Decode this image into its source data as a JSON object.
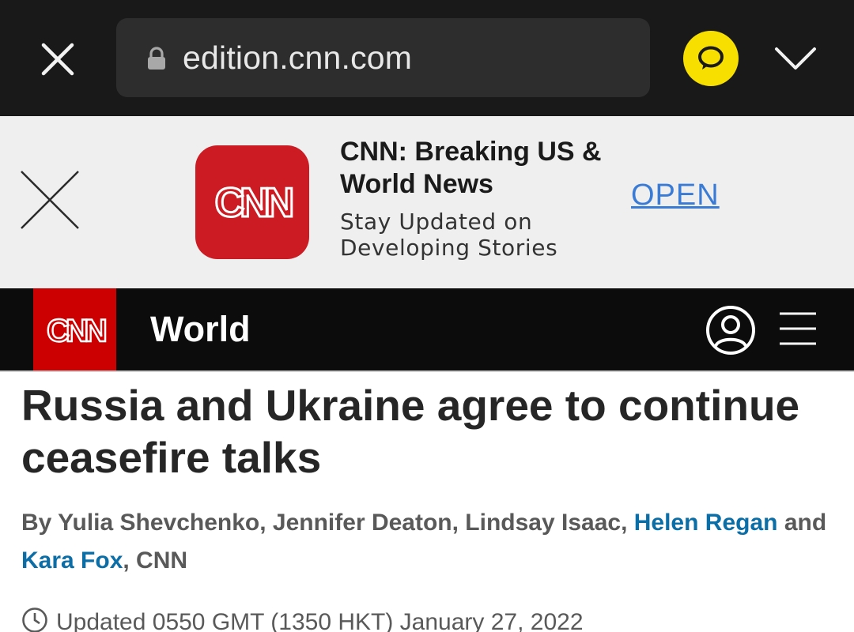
{
  "browser": {
    "url": "edition.cnn.com"
  },
  "app_banner": {
    "app_title": "CNN: Breaking US & World News",
    "app_subtitle": "Stay Updated on Developing Stories",
    "open_label": "OPEN",
    "icon_text": "CNN",
    "icon_color": "#cc1b22"
  },
  "header": {
    "logo_text": "CNN",
    "section": "World",
    "logo_color": "#cc0000"
  },
  "article": {
    "headline": "Russia and Ukraine agree to continue ceasefire talks",
    "byline_prefix": "By Yulia Shevchenko, Jennifer Deaton, Lindsay Isaac,",
    "author_link_1": "Helen Regan",
    "byline_and": "and",
    "author_link_2": "Kara Fox",
    "byline_suffix": ", CNN",
    "updated": "Updated 0550 GMT (1350 HKT) January 27, 2022"
  },
  "icons": [
    "close-icon",
    "lock-icon",
    "kakao-chat-icon",
    "chevron-down-icon",
    "account-icon",
    "hamburger-menu-icon",
    "clock-icon"
  ]
}
